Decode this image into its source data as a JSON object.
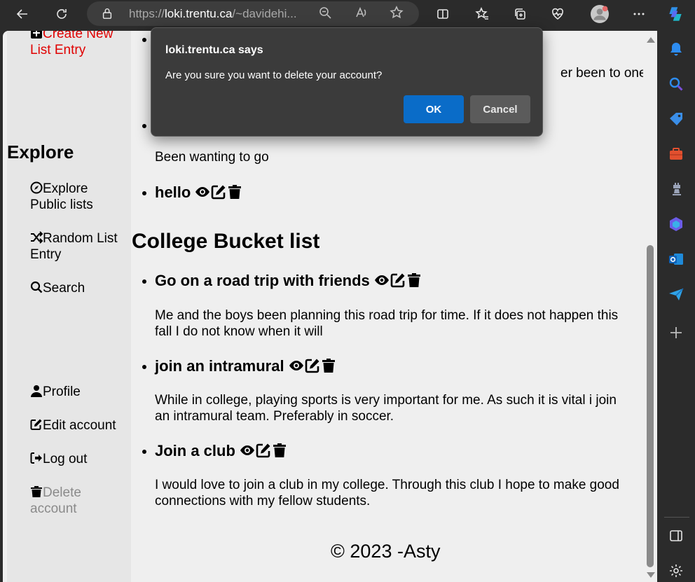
{
  "browser": {
    "url_prefix": "https://",
    "url_host": "loki.trentu.ca",
    "url_rest": "/~davidehi..."
  },
  "sidebar": {
    "create_entry": "Create New List Entry",
    "explore_heading": "Explore",
    "explore_public": "Explore Public lists",
    "random_entry": "Random List Entry",
    "search": "Search",
    "profile": "Profile",
    "edit_account": "Edit account",
    "log_out": "Log out",
    "delete_account": "Delete account"
  },
  "main": {
    "partial_text": "er been to one",
    "first_list_last_desc": "Been wanting to go",
    "first_list_last_item": "hello",
    "section_title": "College Bucket list",
    "items": [
      {
        "title": "Go on a road trip with friends",
        "desc": "Me and the boys been planning this road trip for time. If it does not happen this fall I do not know when it will"
      },
      {
        "title": "join an intramural",
        "desc": "While in college, playing sports is very important for me. As such it is vital i join an intramural team. Preferably in soccer."
      },
      {
        "title": "Join a club",
        "desc": "I would love to join a club in my college. Through this club I hope to make good connections with my fellow students."
      }
    ],
    "footer": "© 2023 -Asty"
  },
  "dialog": {
    "title": "loki.trentu.ca says",
    "message": "Are you sure you want to delete your account?",
    "ok": "OK",
    "cancel": "Cancel"
  },
  "colors": {
    "ok_button": "#0a6cc8",
    "create_link": "#e00000",
    "delete_link": "#8a8a8a"
  }
}
